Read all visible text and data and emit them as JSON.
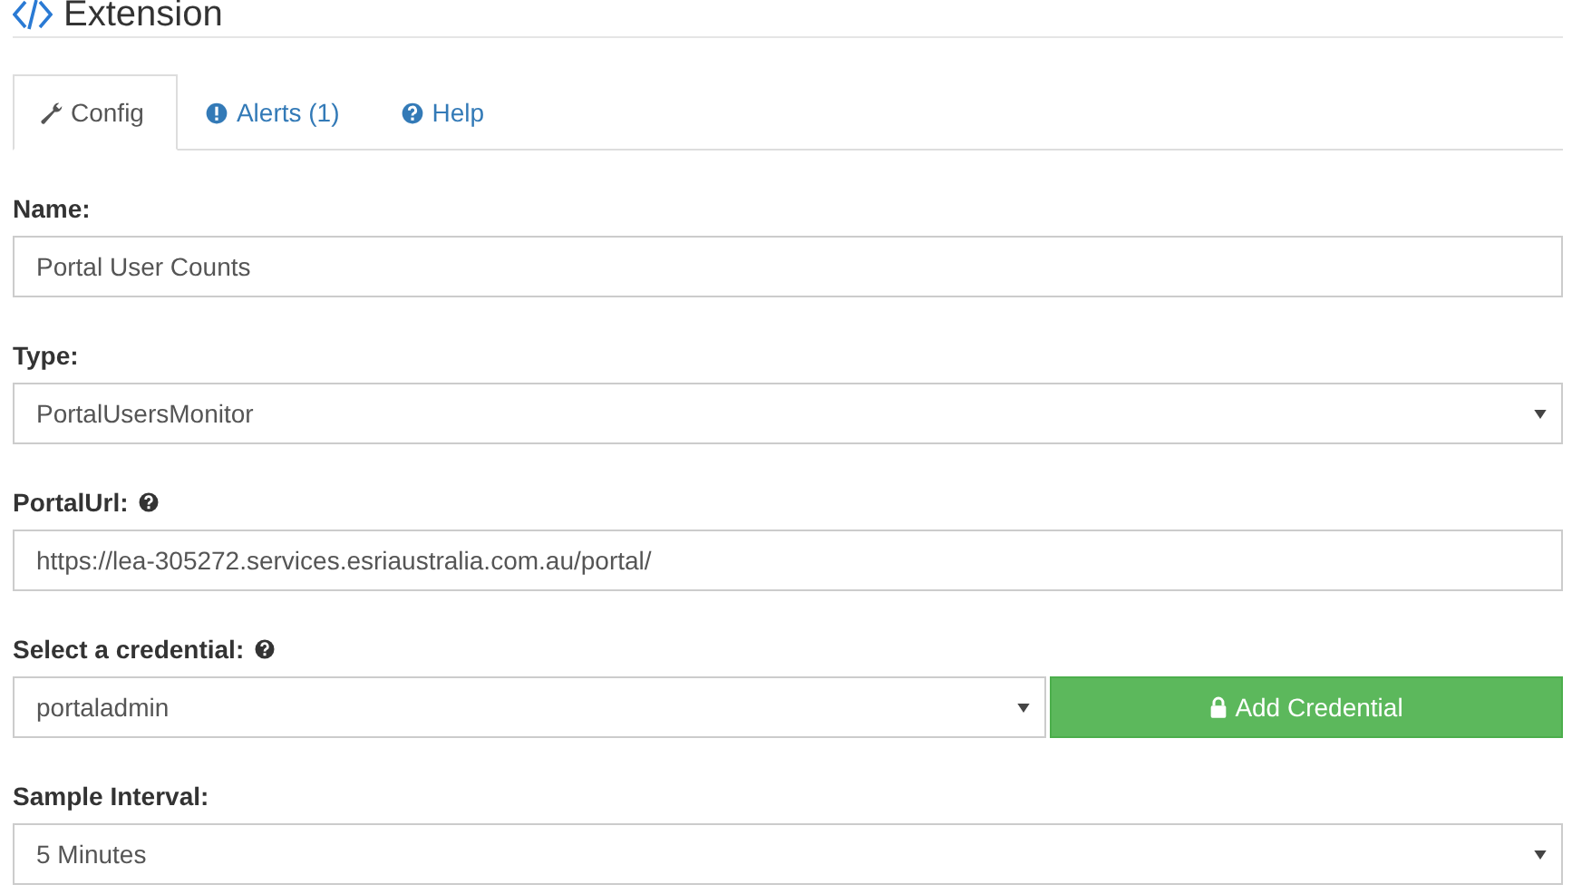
{
  "page": {
    "title": "Extension"
  },
  "tabs": [
    {
      "label": "Config",
      "selected": true
    },
    {
      "label": "Alerts (1)",
      "selected": false
    },
    {
      "label": "Help",
      "selected": false
    }
  ],
  "fields": [
    {
      "kind": "text",
      "label": "Name:",
      "help": false,
      "value": "Portal User Counts"
    },
    {
      "kind": "select",
      "label": "Type:",
      "help": false,
      "value": "PortalUsersMonitor"
    },
    {
      "kind": "text",
      "label": "PortalUrl:",
      "help": true,
      "value": "https://lea-305272.services.esriaustralia.com.au/portal/"
    },
    {
      "kind": "select",
      "label": "Select a credential:",
      "help": true,
      "value": "portaladmin",
      "button": "Add Credential"
    },
    {
      "kind": "select",
      "label": "Sample Interval:",
      "help": false,
      "value": "5 Minutes"
    }
  ]
}
